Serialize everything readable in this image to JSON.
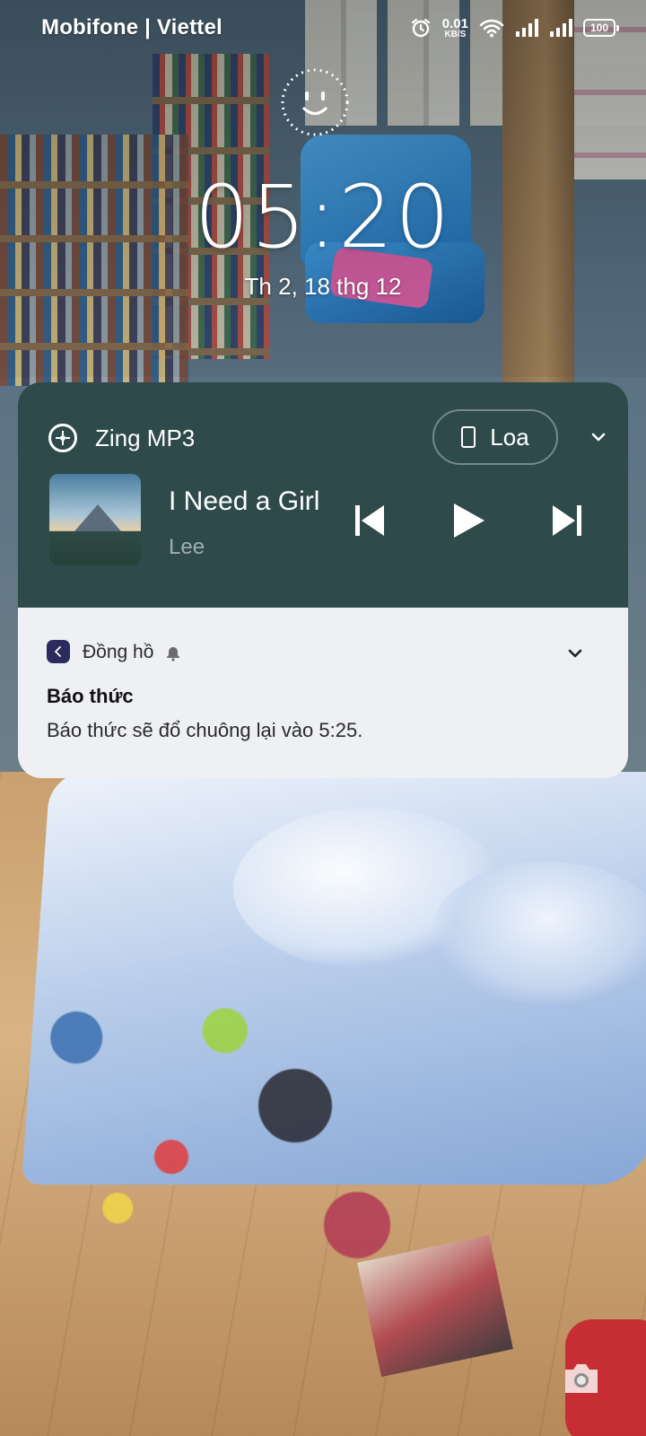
{
  "status_bar": {
    "carrier": "Mobifone | Viettel",
    "net_speed_value": "0.01",
    "net_speed_unit": "KB/S",
    "battery": "100",
    "icons": [
      "alarm-icon",
      "wifi-icon",
      "signal-icon",
      "signal-icon",
      "battery-icon"
    ]
  },
  "lock_screen": {
    "time": "05:20",
    "date": "Th 2, 18 thg 12"
  },
  "media_player": {
    "app_name": "Zing MP3",
    "output_device": "Loa",
    "track_title": "I Need a Girl",
    "artist": "Lee",
    "background_color": "#2f4a4a",
    "controls": [
      "previous-icon",
      "play-icon",
      "next-icon"
    ]
  },
  "notification": {
    "app_name": "Đồng hồ",
    "title": "Báo thức",
    "body": "Báo thức sẽ đổ chuông lại vào 5:25."
  }
}
